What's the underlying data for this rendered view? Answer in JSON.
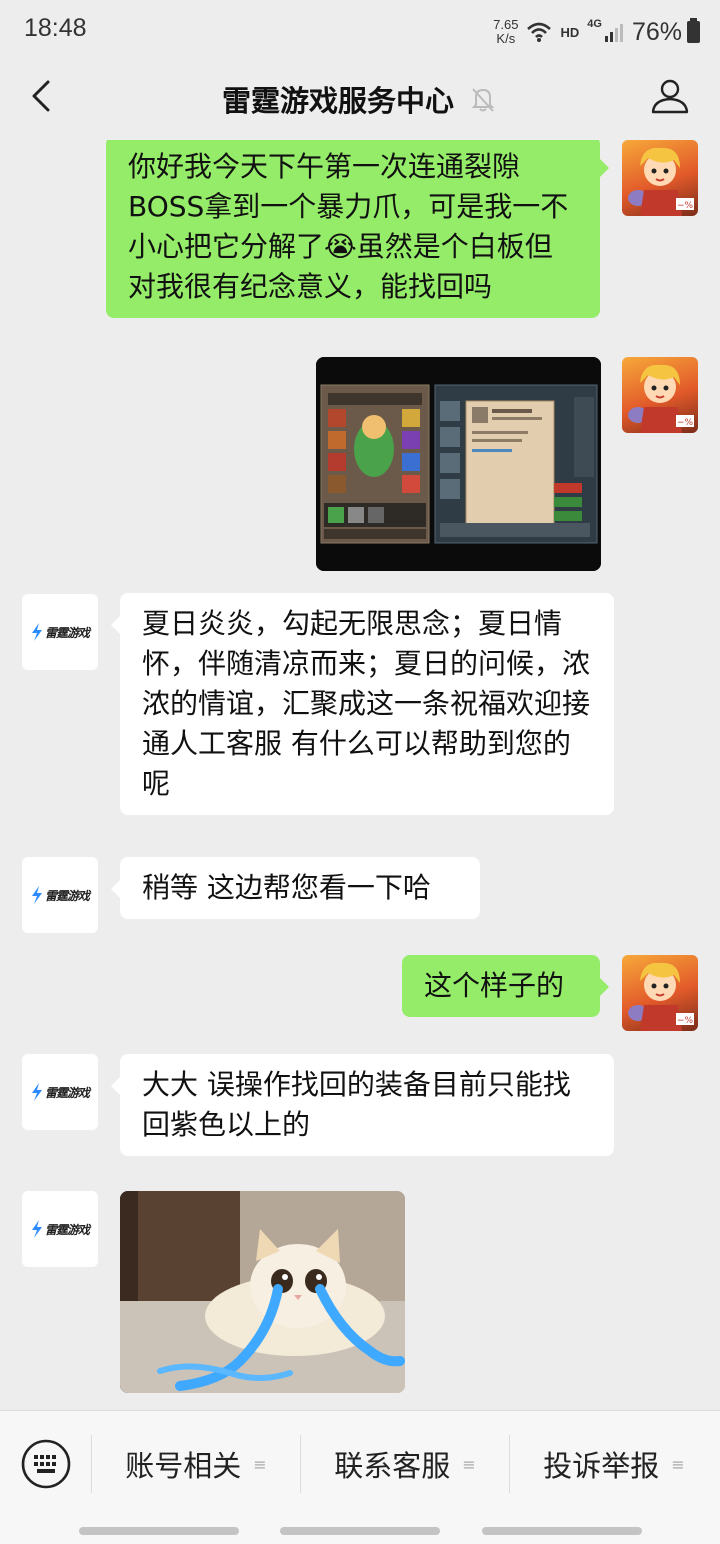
{
  "status_bar": {
    "time": "18:48",
    "net_speed_value": "7.65",
    "net_speed_unit": "K/s",
    "hd_label": "HD",
    "network_label": "4G",
    "battery": "76%"
  },
  "header": {
    "title": "雷霆游戏服务中心",
    "back_icon": "chevron-left-icon",
    "mute_icon": "bell-muted-icon",
    "profile_icon": "person-icon"
  },
  "brand": {
    "logo_text": "雷霆游戏",
    "accent": "#2c8cff"
  },
  "messages": [
    {
      "from": "user",
      "type": "text",
      "text": "你好我今天下午第一次连通裂隙BOSS拿到一个暴力爪，可是我一不小心把它分解了😭虽然是个白板但对我很有纪念意义，能找回吗"
    },
    {
      "from": "user",
      "type": "image",
      "content": "game-screenshot"
    },
    {
      "from": "service",
      "type": "text",
      "text": "夏日炎炎，勾起无限思念；夏日情怀，伴随清凉而来；夏日的问候，浓浓的情谊，汇聚成这一条祝福欢迎接通人工客服 有什么可以帮助到您的呢"
    },
    {
      "from": "service",
      "type": "text",
      "text": "稍等 这边帮您看一下哈"
    },
    {
      "from": "user",
      "type": "text",
      "text": "这个样子的"
    },
    {
      "from": "service",
      "type": "text",
      "text": "大大 误操作找回的装备目前只能找回紫色以上的"
    },
    {
      "from": "service",
      "type": "image",
      "content": "crying-cat-sticker"
    }
  ],
  "bottom_menu": {
    "keyboard_icon": "keyboard-icon",
    "items": [
      {
        "label": "账号相关"
      },
      {
        "label": "联系客服"
      },
      {
        "label": "投诉举报"
      }
    ],
    "item_glyph": "≡"
  },
  "colors": {
    "background": "#ededed",
    "outgoing_bubble": "#95ec69",
    "incoming_bubble": "#ffffff"
  }
}
